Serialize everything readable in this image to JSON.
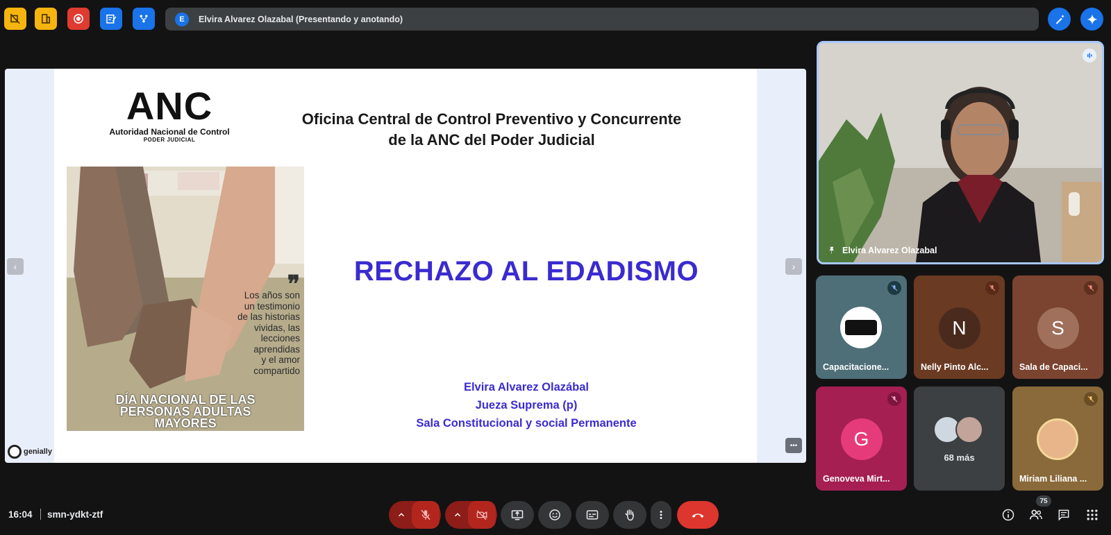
{
  "banner": {
    "avatar_letter": "E",
    "text": "Elvira Alvarez Olazabal (Presentando y anotando)"
  },
  "slide": {
    "logo_big": "ANC",
    "logo_line1": "Autoridad Nacional de Control",
    "logo_line2": "PODER JUDICIAL",
    "heading_line1": "Oficina Central de Control Preventivo y Concurrente",
    "heading_line2": "de la ANC del Poder Judicial",
    "title": "RECHAZO AL EDADISMO",
    "presenter_name": "Elvira Alvarez Olazábal",
    "presenter_role": "Jueza Suprema (p)",
    "presenter_sala": "Sala Constitucional y social Permanente",
    "poster_quote": [
      "Los años son",
      "un testimonio",
      "de las historias",
      "vividas, las",
      "lecciones",
      "aprendidas",
      "y el amor",
      "compartido"
    ],
    "poster_foot": [
      "DÍA NACIONAL DE LAS",
      "PERSONAS ADULTAS",
      "MAYORES"
    ],
    "genially_label": "genially",
    "nav_prev": "‹",
    "nav_next": "›",
    "more": "•••"
  },
  "main_speaker": {
    "name": "Elvira Alvarez Olazabal"
  },
  "participants": [
    {
      "name": "Capacitacione...",
      "avatar": "logo",
      "bg": "#4e6e78",
      "muted": true
    },
    {
      "name": "Nelly Pinto Alc...",
      "avatar": "N",
      "bg": "#6a3a23",
      "muted": true
    },
    {
      "name": "Sala de Capaci...",
      "avatar": "S",
      "bg": "#7a4430",
      "muted": true
    },
    {
      "name": "Genoveva Mirt...",
      "avatar": "G",
      "bg": "#a51f52",
      "muted": true
    },
    {
      "name": "68 más",
      "avatar": "group",
      "bg": "#3c4043",
      "muted": false
    },
    {
      "name": "Miriam Liliana ...",
      "avatar": "photo",
      "bg": "#8a6a3a",
      "muted": true
    }
  ],
  "bottom": {
    "time": "16:04",
    "meeting_code": "smn-ydkt-ztf",
    "participant_count": "75"
  },
  "colors": {
    "background": "#131314",
    "accent_blue": "#1a73e8",
    "danger_red": "#ea4335",
    "slide_title": "#3a2bd0"
  }
}
